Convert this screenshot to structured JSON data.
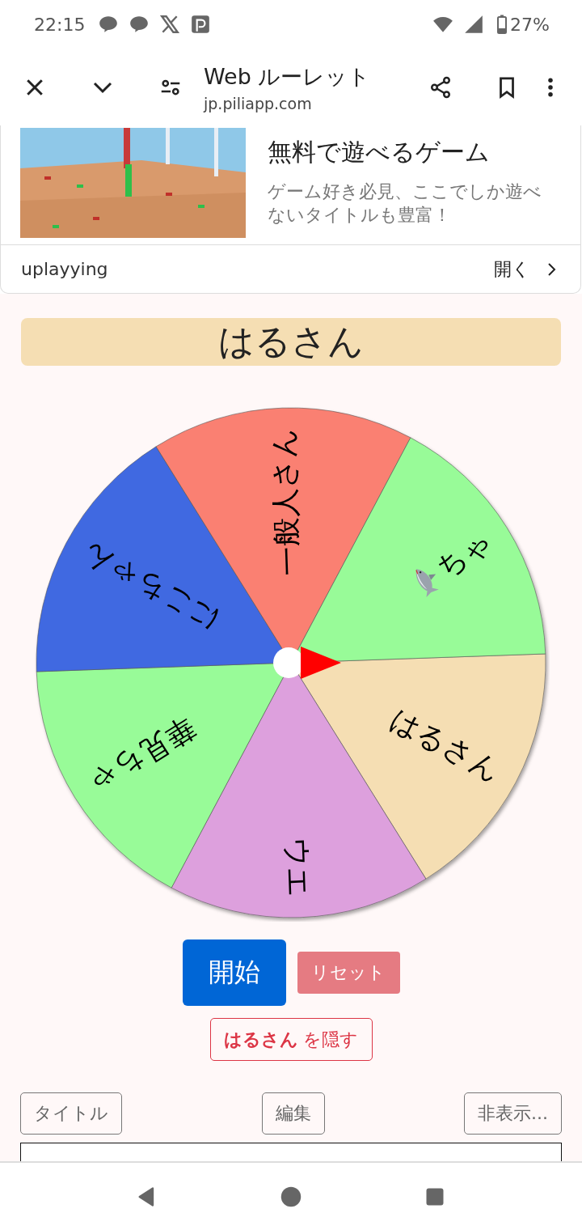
{
  "status_bar": {
    "time": "22:15",
    "battery": "27%"
  },
  "browser": {
    "title": "Web ルーレット",
    "url": "jp.piliapp.com"
  },
  "ad": {
    "headline": "無料で遊べるゲーム",
    "description": "ゲーム好き必見、ここでしか遊べないタイトルも豊富！",
    "advertiser": "uplayying",
    "open": "開く"
  },
  "result": "はるさん",
  "wheel": {
    "segments": [
      {
        "label": "はるさん",
        "color": "#f5deb3",
        "kind": "text"
      },
      {
        "label": "ウエ",
        "color": "#dda0dd",
        "kind": "text"
      },
      {
        "label": "華見ちゃ",
        "color": "#98fb98",
        "kind": "text"
      },
      {
        "label": "にこちゃん",
        "color": "#4169e1",
        "kind": "text"
      },
      {
        "label": "一般人さん",
        "color": "#fa8072",
        "kind": "text"
      },
      {
        "label": "ちゃ",
        "color": "#98fb98",
        "kind": "icon_text"
      }
    ]
  },
  "buttons": {
    "start": "開始",
    "reset": "リセット",
    "hide": "**はるさん** を隠す"
  },
  "toolbar": [
    "タイトル",
    "編集",
    "非表示..."
  ]
}
